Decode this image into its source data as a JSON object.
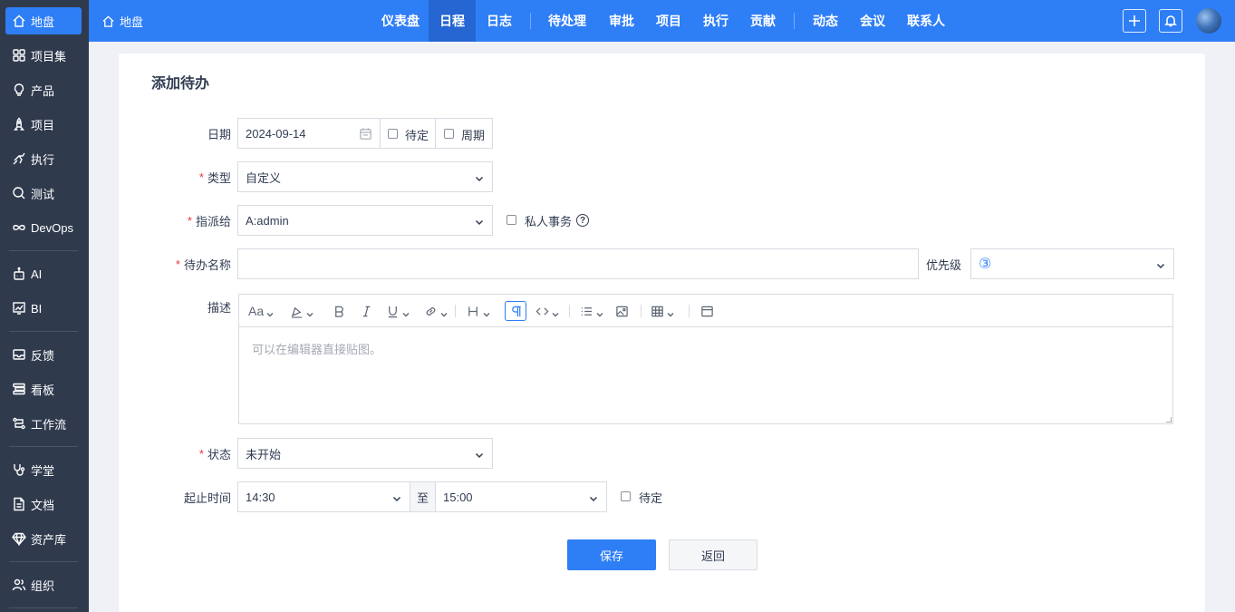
{
  "sidebar": {
    "items": [
      {
        "label": "地盘",
        "icon": "home-icon"
      },
      {
        "label": "项目集",
        "icon": "grid-icon"
      },
      {
        "label": "产品",
        "icon": "lightbulb-icon"
      },
      {
        "label": "项目",
        "icon": "rocket-icon"
      },
      {
        "label": "执行",
        "icon": "run-icon"
      },
      {
        "label": "测试",
        "icon": "magnifier-icon"
      },
      {
        "label": "DevOps",
        "icon": "infinity-icon"
      },
      {
        "label": "AI",
        "icon": "robot-icon"
      },
      {
        "label": "BI",
        "icon": "chart-icon"
      },
      {
        "label": "反馈",
        "icon": "feedback-icon"
      },
      {
        "label": "看板",
        "icon": "kanban-icon"
      },
      {
        "label": "工作流",
        "icon": "workflow-icon"
      },
      {
        "label": "学堂",
        "icon": "stethoscope-icon"
      },
      {
        "label": "文档",
        "icon": "document-icon"
      },
      {
        "label": "资产库",
        "icon": "diamond-icon"
      },
      {
        "label": "组织",
        "icon": "people-icon"
      }
    ]
  },
  "header": {
    "crumb": "地盘",
    "nav": [
      "仪表盘",
      "日程",
      "日志",
      "待处理",
      "审批",
      "项目",
      "执行",
      "贡献",
      "动态",
      "会议",
      "联系人"
    ],
    "active_nav": "日程"
  },
  "form": {
    "title": "添加待办",
    "date_label": "日期",
    "date_value": "2024-09-14",
    "date_pending_label": "待定",
    "cycle_label": "周期",
    "type_label": "类型",
    "type_value": "自定义",
    "assign_label": "指派给",
    "assign_value": "A:admin",
    "private_label": "私人事务",
    "name_label": "待办名称",
    "name_value": "",
    "priority_label": "优先级",
    "priority_value": "③",
    "desc_label": "描述",
    "desc_placeholder": "可以在编辑器直接贴图。",
    "status_label": "状态",
    "status_value": "未开始",
    "time_label": "起止时间",
    "time_start": "14:30",
    "time_to": "至",
    "time_end": "15:00",
    "time_pending_label": "待定",
    "save_label": "保存",
    "back_label": "返回"
  },
  "colors": {
    "accent": "#2e7ef6",
    "sidebar_bg": "#303a4d",
    "required": "#e4393c"
  }
}
